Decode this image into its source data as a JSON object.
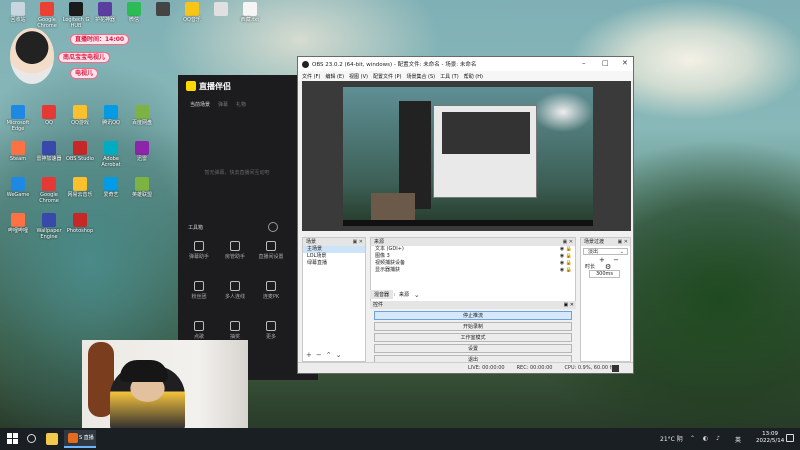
{
  "desktop": {
    "top_icons": [
      "回收站",
      "Google Chrome",
      "Logitech G HUB",
      "护花神器",
      "微信",
      "",
      "QQ音乐",
      "",
      "西藏.txt"
    ],
    "left_icons": [
      "Microsoft Edge",
      "QQ",
      "QQ游戏",
      "腾讯QQ",
      "百度网盘",
      "Steam",
      "雷神加速器",
      "OBS Studio",
      "Adobe Acrobat",
      "迅雷",
      "WeGame",
      "Google Chrome",
      "网易云音乐",
      "爱奇艺",
      "英雄联盟",
      "哔哩哔哩",
      "Wallpaper Engine",
      "Photoshop"
    ]
  },
  "streamer_widget": {
    "badge_time": "直播时间：14:00",
    "channel_name": "南瓜宝宝电视儿",
    "nick": "电视儿"
  },
  "companion": {
    "title": "直播伴侣",
    "tabs": [
      "当前场景",
      "弹幕",
      "礼物"
    ],
    "empty_text": "暂无弹幕，快去直播间互动吧",
    "tools_title": "工具箱",
    "tools": [
      "弹幕助手",
      "房管助手",
      "直播间设置",
      "粉丝团",
      "多人连线",
      "连麦PK",
      "点歌",
      "抽奖",
      "更多"
    ]
  },
  "obs": {
    "title": "OBS 23.0.2 (64-bit, windows) - 配置文件: 未命名 - 场景: 未命名",
    "menu": [
      "文件 (F)",
      "编辑 (E)",
      "视图 (V)",
      "配置文件 (P)",
      "场景集合 (S)",
      "工具 (T)",
      "帮助 (H)"
    ],
    "scenes_title": "场景",
    "scenes": [
      "主场景",
      "LOL场景",
      "绿幕直播"
    ],
    "sources_title": "来源",
    "sources": [
      "文本 (GDI+)",
      "图像 3",
      "视频捕获设备",
      "显示器捕获"
    ],
    "transitions_title": "场景过渡",
    "transition_value": "淡出",
    "duration_label": "时长",
    "duration_value": "300ms",
    "mixer_tabs": [
      "混音器",
      "来源"
    ],
    "controls_title": "控件",
    "controls": [
      "停止推流",
      "开始录制",
      "工作室模式",
      "设置",
      "退出"
    ],
    "status": {
      "live": "LIVE: 00:00:00",
      "rec": "REC: 00:00:00",
      "cpu": "CPU: 0.9%, 60.00 fps"
    }
  },
  "taskbar": {
    "weather": "21°C 阴",
    "lang": "英",
    "time": "13:09",
    "date": "2022/5/14",
    "active_app": "S 直播"
  }
}
